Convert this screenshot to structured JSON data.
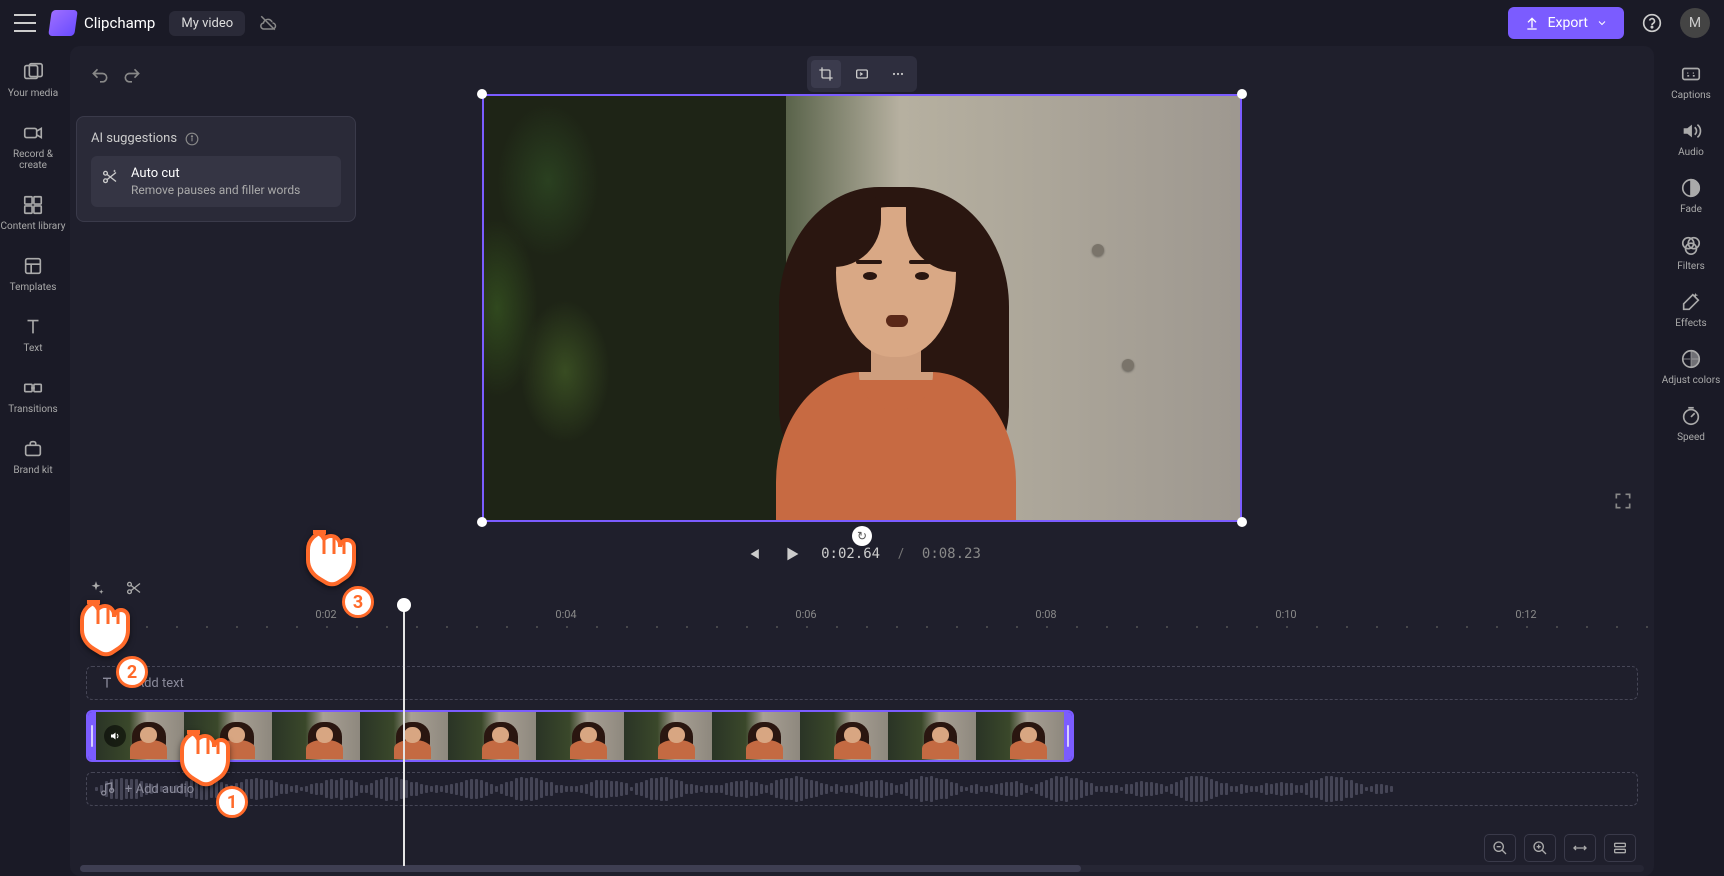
{
  "header": {
    "app_name": "Clipchamp",
    "project_name": "My video",
    "export_label": "Export",
    "avatar_initial": "M"
  },
  "left_rail": [
    {
      "label": "Your media"
    },
    {
      "label": "Record & create"
    },
    {
      "label": "Content library"
    },
    {
      "label": "Templates"
    },
    {
      "label": "Text"
    },
    {
      "label": "Transitions"
    },
    {
      "label": "Brand kit"
    }
  ],
  "right_rail": [
    {
      "label": "Captions"
    },
    {
      "label": "Audio"
    },
    {
      "label": "Fade"
    },
    {
      "label": "Filters"
    },
    {
      "label": "Effects"
    },
    {
      "label": "Adjust colors"
    },
    {
      "label": "Speed"
    }
  ],
  "ai_popup": {
    "title": "AI suggestions",
    "item_title": "Auto cut",
    "item_subtitle": "Remove pauses and filler words"
  },
  "playback": {
    "current": "0:02.64",
    "separator": "/",
    "total": "0:08.23"
  },
  "ruler_marks": [
    "0:02",
    "0:04",
    "0:06",
    "0:08",
    "0:10",
    "0:12"
  ],
  "tracks": {
    "text_prompt": "+ Add text",
    "audio_prompt": "+ Add audio"
  },
  "annotations": {
    "p1": "1",
    "p2": "2",
    "p3": "3"
  }
}
